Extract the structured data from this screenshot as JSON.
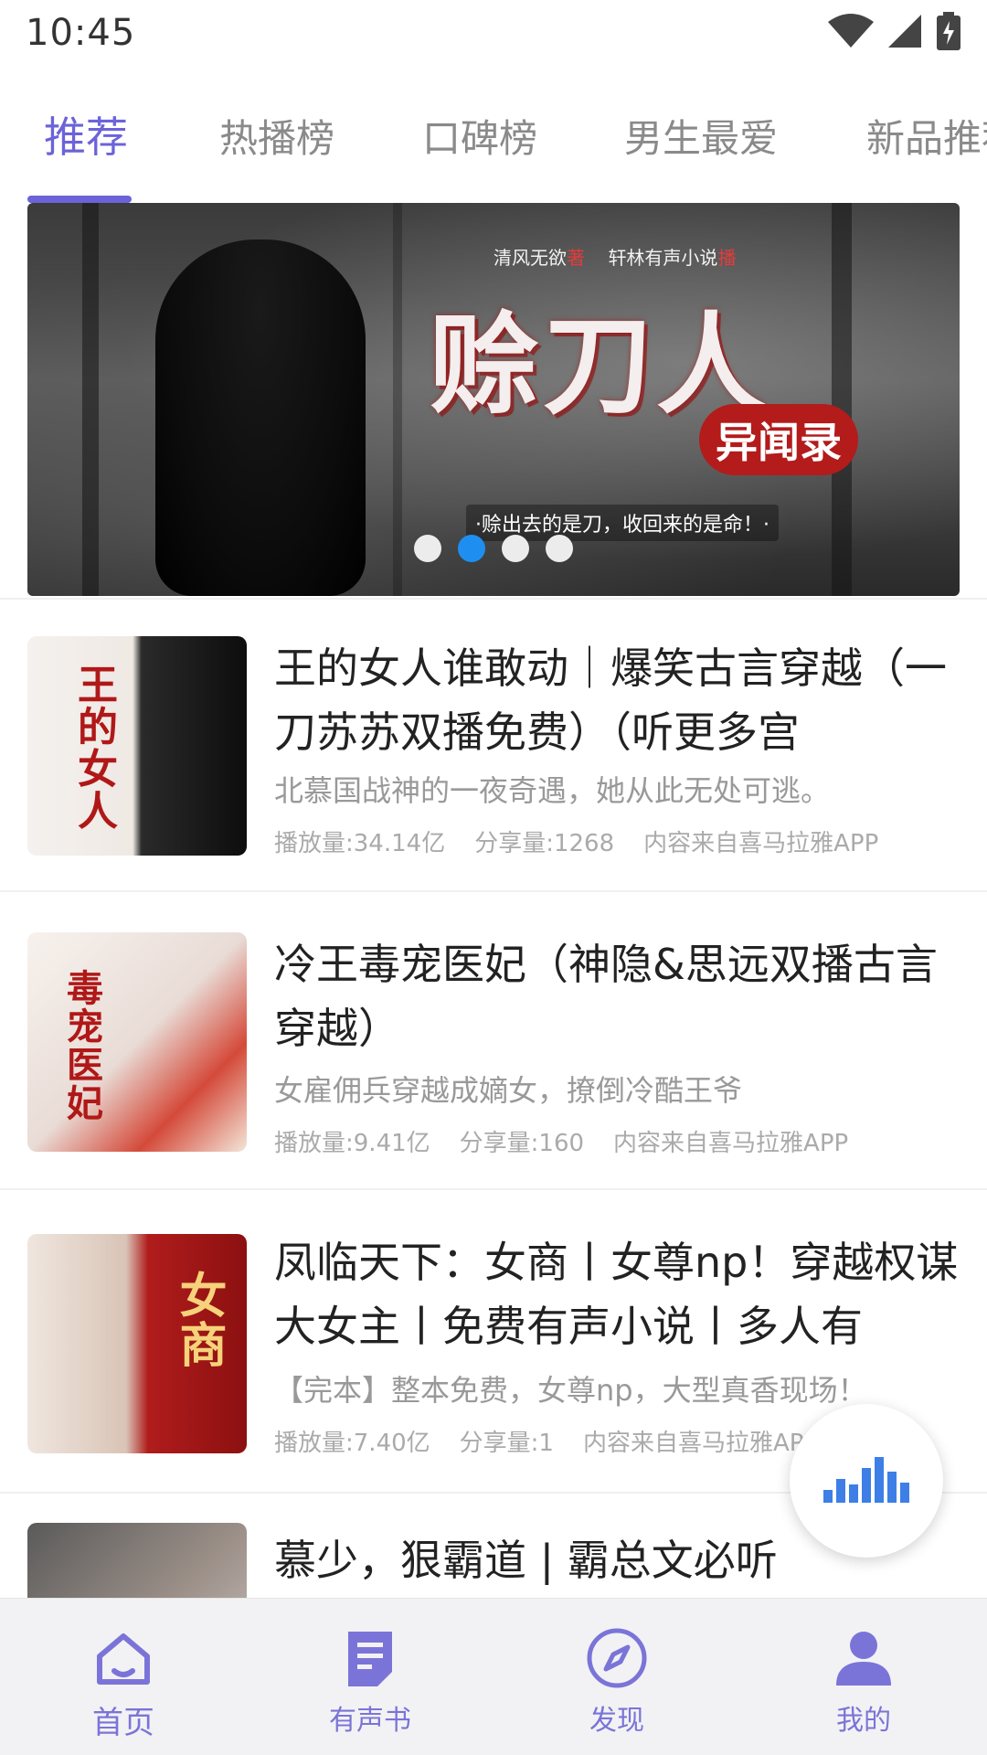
{
  "status_bar": {
    "time": "10:45",
    "icons": [
      "wifi-icon",
      "signal-icon",
      "battery-charging-icon"
    ]
  },
  "tabs": [
    {
      "label": "推荐",
      "active": true
    },
    {
      "label": "热播榜",
      "active": false
    },
    {
      "label": "口碑榜",
      "active": false
    },
    {
      "label": "男生最爱",
      "active": false
    },
    {
      "label": "新品推荐",
      "active": false
    }
  ],
  "banner": {
    "credits_author": "清风无欲",
    "credits_author_role": "著",
    "credits_narrator": "轩林有声小说",
    "credits_narrator_role": "播",
    "title": "赊刀人",
    "subtitle": "异闻录",
    "tagline": "·赊出去的是刀，收回来的是命！·",
    "page_count": 4,
    "active_page": 2
  },
  "items": [
    {
      "title": "王的女人谁敢动｜爆笑古言穿越（一刀苏苏双播免费）（听更多宫",
      "desc": "北慕国战神的一夜奇遇，她从此无处可逃。",
      "plays": "播放量:34.14亿",
      "shares": "分享量:1268",
      "source": "内容来自喜马拉雅APP",
      "cover_text": "王的女人"
    },
    {
      "title": "冷王毒宠医妃（神隐&思远双播古言穿越）",
      "desc": "女雇佣兵穿越成嫡女，撩倒冷酷王爷",
      "plays": "播放量:9.41亿",
      "shares": "分享量:160",
      "source": "内容来自喜马拉雅APP",
      "cover_text": "毒宠医妃"
    },
    {
      "title": "凤临天下：女商丨女尊np！穿越权谋大女主丨免费有声小说丨多人有",
      "desc": "【完本】整本免费，女尊np，大型真香现场！",
      "plays": "播放量:7.40亿",
      "shares": "分享量:1",
      "source": "内容来自喜马拉雅APP",
      "cover_text": "女商"
    },
    {
      "title": "慕少，狠霸道 | 霸总文必听",
      "desc": "",
      "plays": "",
      "shares": "",
      "source": "",
      "cover_text": ""
    }
  ],
  "fab": {
    "icon": "audio-bars-icon"
  },
  "bottom_nav": [
    {
      "label": "首页",
      "icon": "home-icon",
      "active": true
    },
    {
      "label": "有声书",
      "icon": "book-icon",
      "active": false
    },
    {
      "label": "发现",
      "icon": "compass-icon",
      "active": false
    },
    {
      "label": "我的",
      "icon": "profile-icon",
      "active": false
    }
  ],
  "colors": {
    "accent": "#6c63d9",
    "dot_active": "#1e8ff0",
    "fab_bars": "#3d7fe6"
  }
}
